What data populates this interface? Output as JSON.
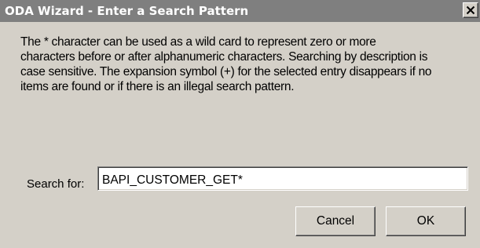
{
  "window": {
    "title": "ODA Wizard - Enter a Search Pattern",
    "close_symbol": "×"
  },
  "description": {
    "lines": [
      "The * character can be used as a wild card to represent zero or more",
      "characters before or after alphanumeric characters. Searching by description is",
      "case sensitive. The expansion symbol (+) for the selected entry disappears if no",
      "items are found or if there is an illegal search pattern."
    ]
  },
  "search": {
    "label": "Search for:",
    "value": "BAPI_CUSTOMER_GET*"
  },
  "buttons": {
    "cancel_label": "Cancel",
    "ok_label": "OK"
  },
  "icons": {
    "close": "close-icon"
  },
  "colors": {
    "titlebar": "#7f7f7f",
    "dialog_background": "#d4d0c8",
    "text": "#000000",
    "title_text": "#ffffff"
  }
}
